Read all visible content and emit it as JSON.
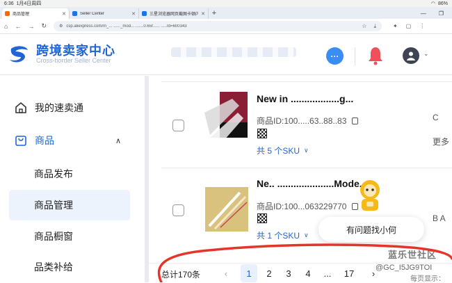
{
  "status_bar": {
    "time": "6:36",
    "date": "1月4日周四",
    "battery": "86%"
  },
  "tabs": [
    {
      "label": "商品管理",
      "active": true,
      "favicon": "aliexpress"
    },
    {
      "label": "Seller Center",
      "active": false,
      "favicon": "aliexpress"
    },
    {
      "label": "三星浏览器网页截图卡顿闪退，如",
      "active": false,
      "favicon": "aliexpress"
    }
  ],
  "new_tab_label": "+",
  "address_bar": {
    "url": "csp.aliexpress.com/m_... ......_mod... .......0.65f...... .....rd=600343"
  },
  "header": {
    "logo_title": "跨境卖家中心",
    "logo_subtitle": "Cross-border Seller Center",
    "chat_icon_label": "···",
    "accent": "#1f65d6"
  },
  "sidebar": {
    "items": [
      {
        "label": "我的速卖通",
        "icon": "home-icon"
      },
      {
        "label": "商品",
        "icon": "bag-icon",
        "chevron": "∧",
        "active": true
      }
    ],
    "sub_items": [
      {
        "label": "商品发布",
        "selected": false
      },
      {
        "label": "商品管理",
        "selected": true
      },
      {
        "label": "商品橱窗",
        "selected": false
      },
      {
        "label": "品类补给",
        "selected": false
      }
    ]
  },
  "products": [
    {
      "title": "New in ..................g...",
      "id": "商品ID:100.....63..88..83",
      "sku": "共 5 个SKU",
      "right_top": "C",
      "right_bottom": "更多"
    },
    {
      "title": "Ne.. .....................Mode...",
      "id": "商品ID:100...063229770",
      "sku": "共 1 个SKU",
      "right_top": "",
      "right_bottom": "B A"
    }
  ],
  "help_bubble": "有问题找小何",
  "pagination": {
    "total": "总计170条",
    "prev": "‹",
    "pages": [
      "1",
      "2",
      "3",
      "4",
      "...",
      "17"
    ],
    "next": "›",
    "per_page": "每页显示："
  },
  "watermark": {
    "line1": "蓝乐世社区",
    "line2": "@GC_I5JG9TOI"
  }
}
